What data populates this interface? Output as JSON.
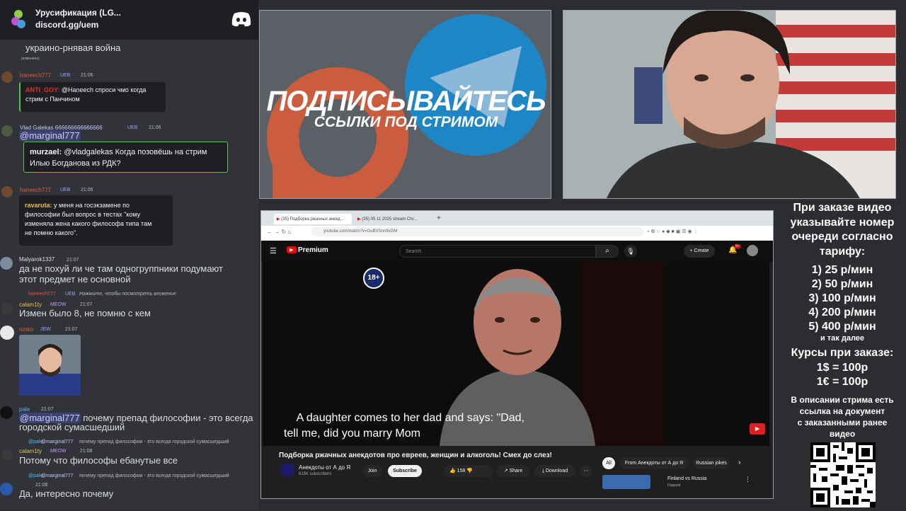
{
  "discord": {
    "server_name": "Урусификация (LG...",
    "server_invite": "discord.gg/uem",
    "messages": [
      {
        "text": "украино-рнявая война",
        "sub": "(изменено)"
      },
      {
        "user": "haneech777",
        "badge": "UEB",
        "time": "21:06",
        "quote_user": "ANTI_GOY:",
        "quote_line1": "@Haneech спроси чмо когда",
        "quote_line2": "стрим с Панчином"
      },
      {
        "user": "Vlad Galekas 666666666666666",
        "badge": "UEB",
        "time": "21:06",
        "mention": "@marginal777",
        "quote_user": "murzael:",
        "quote_line1": "@vladgalekas Когда позовёшь на стрим",
        "quote_line2": "Илью Богданова из РДК?"
      },
      {
        "user": "haneech777",
        "badge": "UEB",
        "time": "21:06",
        "quote_user": "ravaruta:",
        "quote_line1": "у меня на госэкзамене по",
        "quote_line2": "философии был вопрос в тестах \"кому",
        "quote_line3": "изменяла жена какого философа типа там",
        "quote_line4": "не помню какого\"."
      },
      {
        "user": "Malyarok1337",
        "time": "21:07",
        "line1": "да не похуй ли  че там одногруппники подумают",
        "line2": "этот предмет не основной"
      },
      {
        "reply_user": "haneech777",
        "reply_badge": "UEB",
        "reply_text": "Нажмите, чтобы посмотреть вложение",
        "user": "calam1ty",
        "badge": "MEOW",
        "time": "21:07",
        "line1": "Измен было 8, не помню с кем"
      },
      {
        "user": "runko",
        "badge": "JEW",
        "time": "21:07"
      },
      {
        "user": "pale",
        "time": "21:07",
        "mention": "@marginal777",
        "line1": " почему препад философии - это всегда",
        "line2": "городской сумасшедший"
      },
      {
        "reply_user": "@pale",
        "reply_mention": "@marginal777",
        "reply_text": "почему препад философии - это всегда городской сумасшедший",
        "user": "calam1ty",
        "badge": "MEOW",
        "time": "21:08",
        "line1": "Потому что философы ебанутые все"
      },
      {
        "reply_user": "@pale",
        "reply_mention": "@marginal777",
        "reply_text": "почему препад философии - это всегда городской сумасшедший",
        "time": "21:08",
        "line1": "Да, интересно почему"
      }
    ]
  },
  "promo": {
    "subscribe": "ПОДПИСЫВАЙТЕСЬ",
    "links": "ССЫЛКИ ПОД СТРИМОМ"
  },
  "browser": {
    "tab1": "(35) Подборка ржачных анекд...",
    "tab2": "(35) 05 11 2025 stream Chr...",
    "url": "youtube.com/watch?v=GuBVSnn9vGM",
    "yt_logo": "Premium",
    "search_placeholder": "Search",
    "create": "Create",
    "notif_count": "9+",
    "age_badge": "18+",
    "subtitle_line1": "A daughter comes to her dad and says: \"Dad,",
    "subtitle_line2": "tell me, did you marry Mom",
    "video_title": "Подборка ржачных анекдотов про евреев, женщин и алкоголь! Смех до слез!",
    "channel_name": "Анекдоты от А до Я",
    "channel_subs": "615K subscribers",
    "join": "Join",
    "subscribe": "Subscribe",
    "likes": "158",
    "share": "Share",
    "download": "Download",
    "chip_all": "All",
    "chip_from": "From Анекдоты от А до Я",
    "chip_russian": "Russian jokes",
    "rec_title": "Finland vs Russia",
    "rec_channel": "Dappsid"
  },
  "price": {
    "l1": "При заказе видео",
    "l2": "указывайте номер",
    "l3": "очереди согласно",
    "l4": "тарифу:",
    "t1": "1) 25 р/мин",
    "t2": "2) 50 р/мин",
    "t3": "3) 100 р/мин",
    "t4": "4) 200 р/мин",
    "t5": "5) 400 р/мин",
    "etc": "и так далее",
    "rates_title": "Курсы при заказе:",
    "rate1": "1$ = 100р",
    "rate2": "1€ = 100р",
    "d1": "В описании стрима есть",
    "d2": "ссылка на документ",
    "d3": "с заказанными ранее",
    "d4": "видео"
  },
  "colors": {
    "discord_bg": "#313338",
    "quote_border_green": "#57c45a",
    "youtube_red": "#ff0000",
    "mention_bg": "#3c4270"
  }
}
